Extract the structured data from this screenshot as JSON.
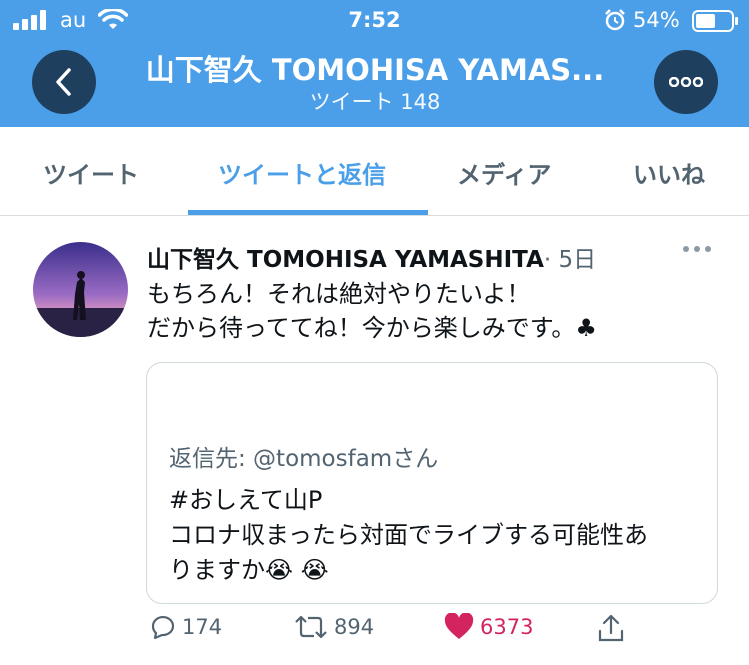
{
  "status_bar": {
    "carrier": "au",
    "time": "7:52",
    "battery_percent": "54%"
  },
  "header": {
    "title": "山下智久 TOMOHISA YAMAS...",
    "subtitle": "ツイート 148",
    "bg_color": "#4a9fe8"
  },
  "tabs": [
    {
      "label": "ツイート"
    },
    {
      "label": "ツイートと返信"
    },
    {
      "label": "メディア"
    },
    {
      "label": "いいね"
    }
  ],
  "active_tab": "ツイートと返信",
  "tweet": {
    "author_name": "山下智久 TOMOHISA YAMASHITA",
    "meta": "· 5日",
    "line1": "もちろん！それは絶対やりたいよ！",
    "line2": "だから待っててね！今から楽しみです。♣",
    "quote": {
      "reply_to": "返信先: @tomosfamさん",
      "line1": "#おしえて山P",
      "line2": "コロナ収まったら対面でライブする可能性あ",
      "line3": "りますか😭 😭"
    },
    "stats": {
      "replies": "174",
      "retweets": "894",
      "likes": "6373"
    }
  },
  "colors": {
    "accent": "#4a9fe8",
    "like": "#d4245f",
    "muted": "#536471"
  }
}
